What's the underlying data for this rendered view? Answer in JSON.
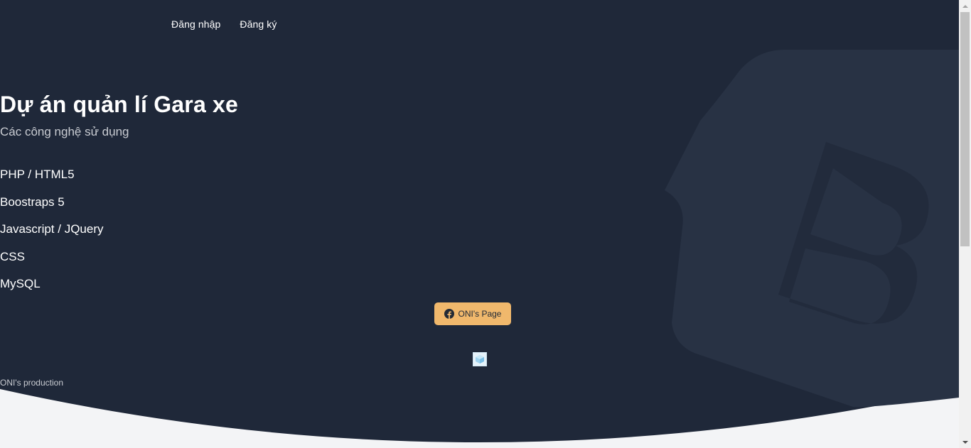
{
  "nav": {
    "login": "Đăng nhập",
    "register": "Đăng ký"
  },
  "hero": {
    "title": "Dự án quản lí Gara xe",
    "subtitle": "Các công nghệ sử dụng",
    "technologies": [
      "PHP / HTML5",
      "Boostraps 5",
      "Javascript / JQuery",
      "CSS",
      "MySQL"
    ]
  },
  "button": {
    "label": "ONI's Page",
    "icon": "facebook-icon"
  },
  "footer": {
    "credit": "ONI's production",
    "logo_icon": "cube-icon"
  },
  "colors": {
    "hero_bg": "#1f2839",
    "hero_shape": "#283244",
    "page_bg": "#f3f4f6",
    "button_bg": "#f0b86c"
  }
}
